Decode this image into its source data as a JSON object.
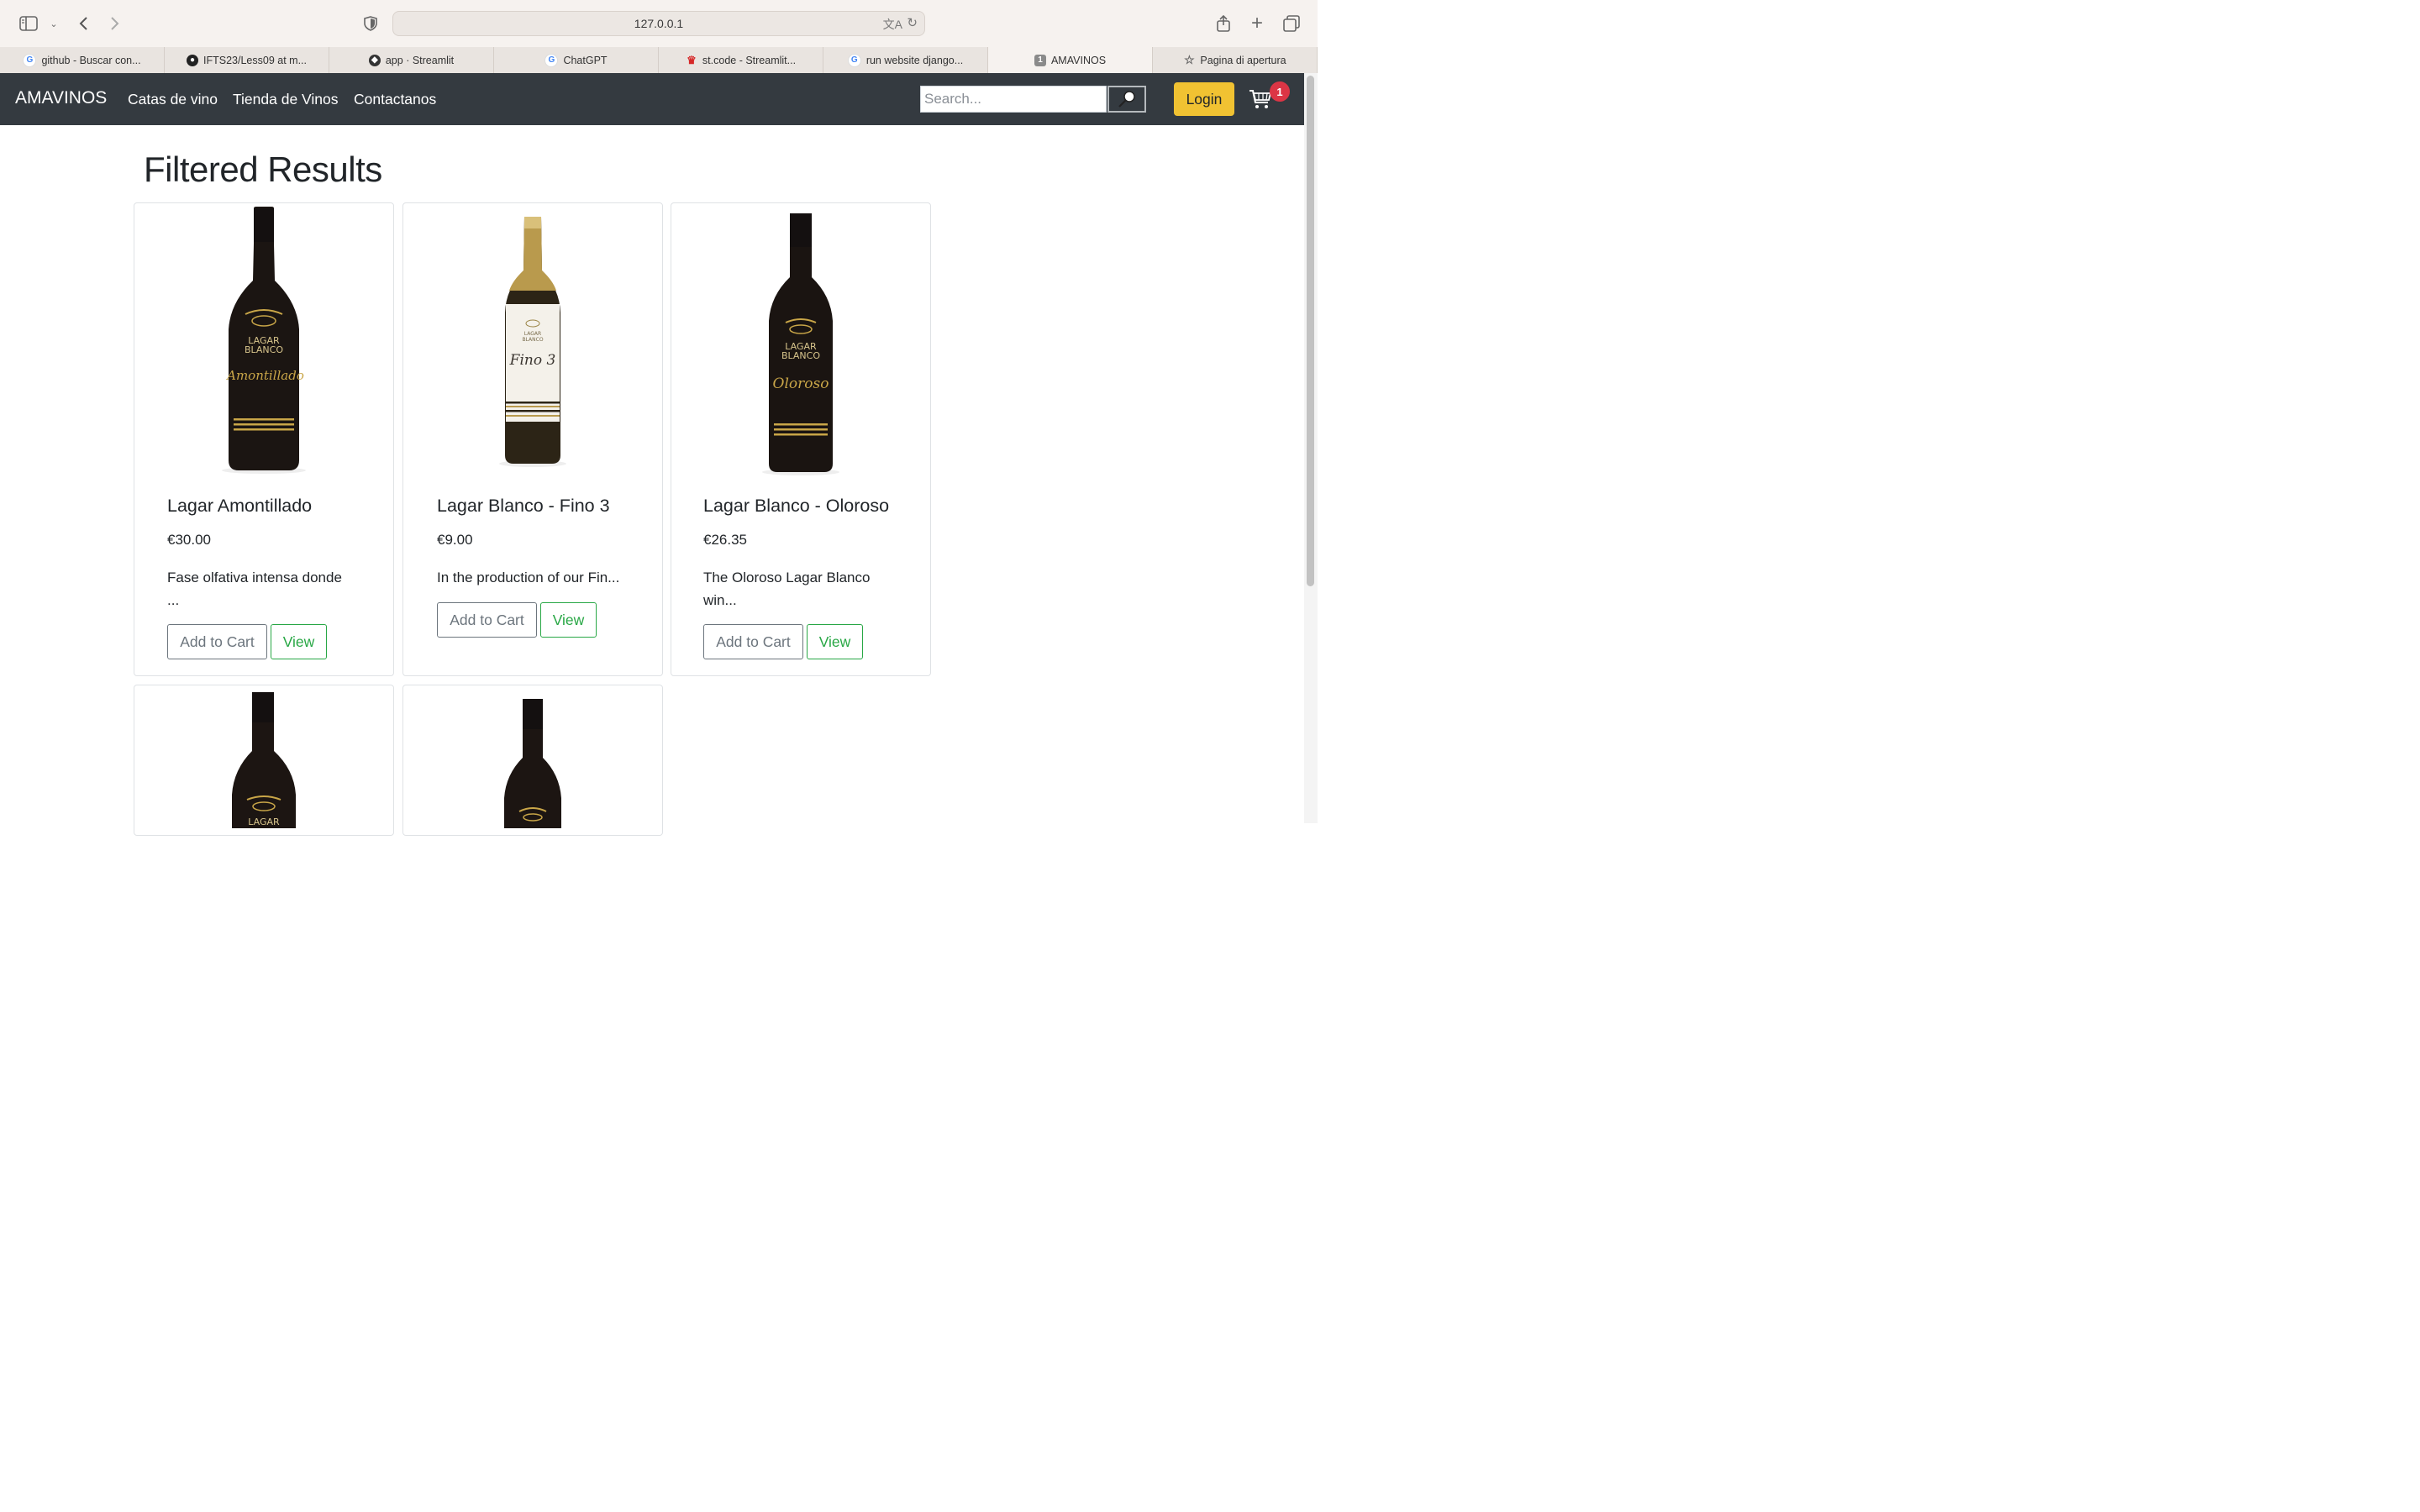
{
  "browser": {
    "url": "127.0.0.1",
    "tabs": [
      {
        "label": "github - Buscar con...",
        "icon": "google-icon"
      },
      {
        "label": "IFTS23/Less09 at m...",
        "icon": "github-icon"
      },
      {
        "label": "app · Streamlit",
        "icon": "streamlit-icon"
      },
      {
        "label": "ChatGPT",
        "icon": "google-icon"
      },
      {
        "label": "st.code - Streamlit...",
        "icon": "crown-icon"
      },
      {
        "label": "run website django...",
        "icon": "google-icon"
      },
      {
        "label": "AMAVINOS",
        "icon": "tab-number-icon",
        "number": "1",
        "active": true
      },
      {
        "label": "Pagina di apertura",
        "icon": "star-icon"
      }
    ]
  },
  "navbar": {
    "brand": "AMAVINOS",
    "links": [
      "Catas de vino",
      "Tienda de Vinos",
      "Contactanos"
    ],
    "search_placeholder": "Search...",
    "login_label": "Login",
    "cart_count": "1",
    "bg_color": "#343a40",
    "login_color": "#f1c232"
  },
  "main": {
    "title": "Filtered Results",
    "products": [
      {
        "name": "Lagar Amontillado",
        "price": "€30.00",
        "desc_line1": "Fase olfativa intensa donde",
        "desc_line2": "...",
        "label_style": "dark",
        "script_text": "Amontillado",
        "add_label": "Add to Cart",
        "view_label": "View"
      },
      {
        "name": "Lagar Blanco - Fino 3",
        "price": "€9.00",
        "desc_line1": "In the production of our Fin...",
        "desc_line2": "",
        "label_style": "white",
        "script_text": "Fino 3",
        "add_label": "Add to Cart",
        "view_label": "View"
      },
      {
        "name": "Lagar Blanco - Oloroso",
        "price": "€26.35",
        "desc_line1": "The Oloroso Lagar Blanco",
        "desc_line2": "win...",
        "label_style": "dark",
        "script_text": "Oloroso",
        "add_label": "Add to Cart",
        "view_label": "View"
      }
    ],
    "partial_cards": 2,
    "bottle_label_text": [
      "LAGAR",
      "BLANCO"
    ]
  }
}
